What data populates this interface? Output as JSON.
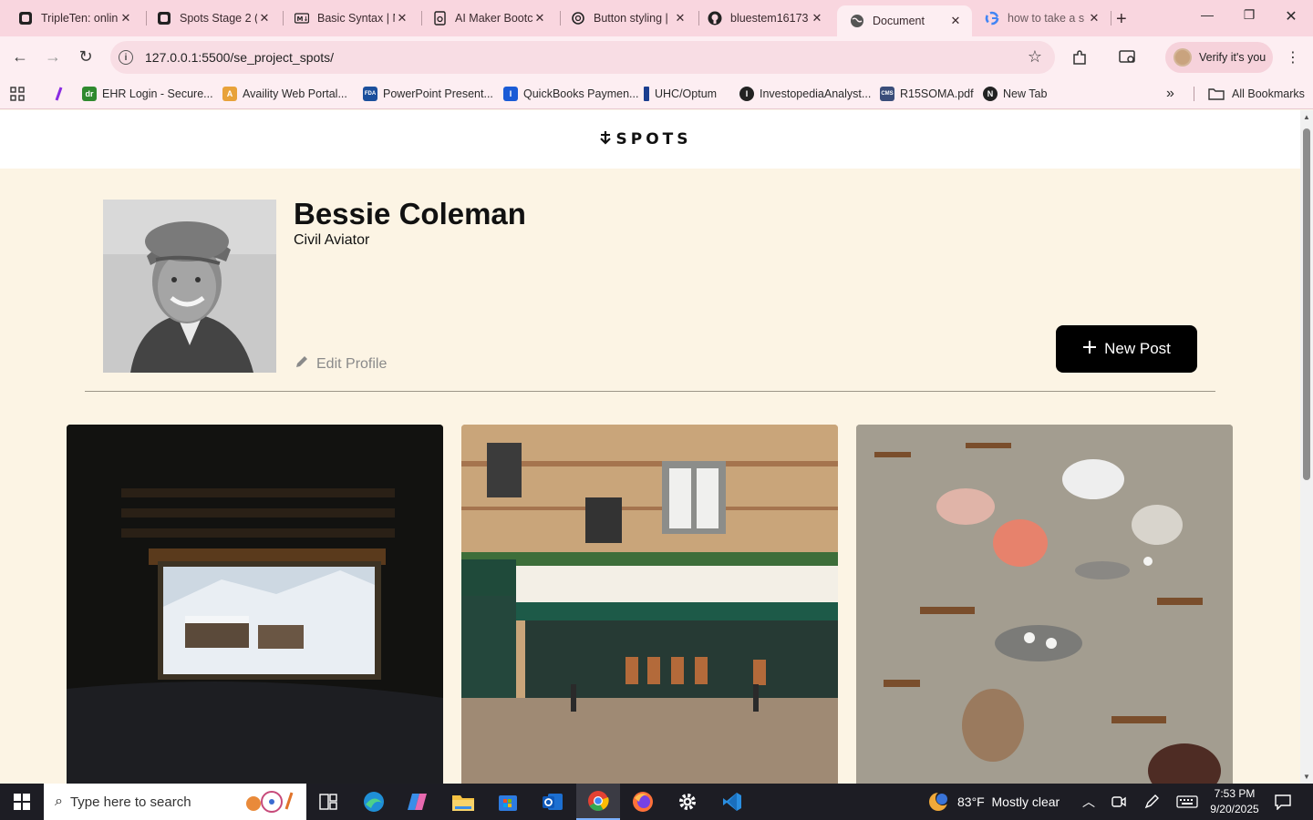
{
  "browser": {
    "tabs": [
      {
        "title": "TripleTen: onlin",
        "icon": "tripleten-icon"
      },
      {
        "title": "Spots Stage 2 (",
        "icon": "tripleten-icon"
      },
      {
        "title": "Basic Syntax | M",
        "icon": "markdown-icon"
      },
      {
        "title": "AI Maker Bootc",
        "icon": "document-icon"
      },
      {
        "title": "Button styling |",
        "icon": "openai-icon"
      },
      {
        "title": "bluestem16173",
        "icon": "github-icon"
      },
      {
        "title": "Document",
        "icon": "globe-icon"
      },
      {
        "title": "how to take a s",
        "icon": "google-icon"
      }
    ],
    "active_tab": "Document",
    "url": "127.0.0.1:5500/se_project_spots/",
    "profile_label": "Verify it's you",
    "bookmarks": [
      {
        "label": "EHR Login - Secure...",
        "color": "#2f8a2f",
        "abbr": "dr"
      },
      {
        "label": "Availity Web Portal...",
        "color": "#e8a23a",
        "abbr": "A"
      },
      {
        "label": "PowerPoint Present...",
        "color": "#1b4f9c",
        "abbr": "FDA"
      },
      {
        "label": "QuickBooks Paymen...",
        "color": "#1a5bd6",
        "abbr": "I"
      },
      {
        "label": "UHC/Optum",
        "color": "#1a3d8f",
        "abbr": "U"
      },
      {
        "label": "InvestopediaAnalyst...",
        "color": "#222222",
        "abbr": "I"
      },
      {
        "label": "R15SOMA.pdf",
        "color": "#3a4d7a",
        "abbr": "CMS"
      },
      {
        "label": "New Tab",
        "color": "#222222",
        "abbr": "N"
      }
    ],
    "all_bookmarks": "All Bookmarks"
  },
  "site": {
    "logo_text": "SPOTS",
    "profile": {
      "name": "Bessie Coleman",
      "description": "Civil Aviator",
      "edit_label": "Edit Profile",
      "new_post_label": "New Post"
    },
    "cards": [
      {
        "alt": "View of snowy mountain village through a dark window"
      },
      {
        "alt": "Paris restaurant facade with green awning"
      },
      {
        "alt": "Outdoor cafe terrace with people seated at tables"
      }
    ]
  },
  "taskbar": {
    "search_placeholder": "Type here to search",
    "weather": "83°F  Mostly clear",
    "time": "7:53 PM",
    "date": "9/20/2025"
  }
}
